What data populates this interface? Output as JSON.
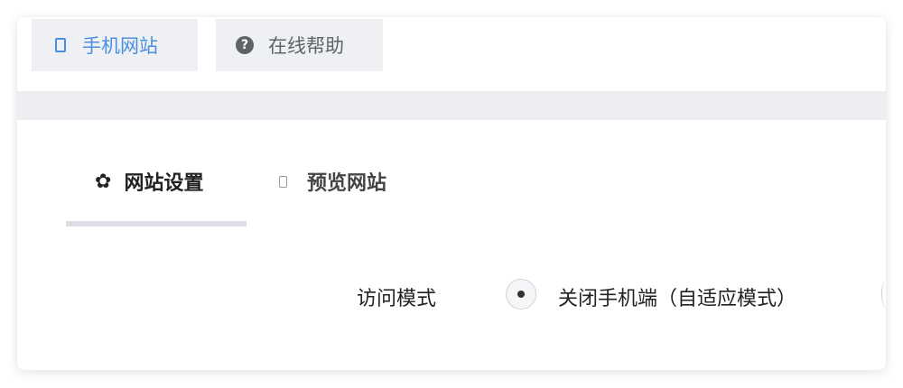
{
  "top_tabs": {
    "mobile_site": {
      "label": "手机网站",
      "icon": "mobile-phone-icon",
      "color": "#4a8fdf"
    },
    "online_help": {
      "label": "在线帮助",
      "icon": "question-circle-icon",
      "color": "#5f6368"
    }
  },
  "sub_tabs": {
    "site_settings": {
      "label": "网站设置",
      "icon": "gear-icon"
    },
    "preview_site": {
      "label": "预览网站",
      "icon": "mobile-phone-icon"
    }
  },
  "form": {
    "access_mode_label": "访问模式",
    "option_close_mobile": "关闭手机端（自适应模式）"
  }
}
